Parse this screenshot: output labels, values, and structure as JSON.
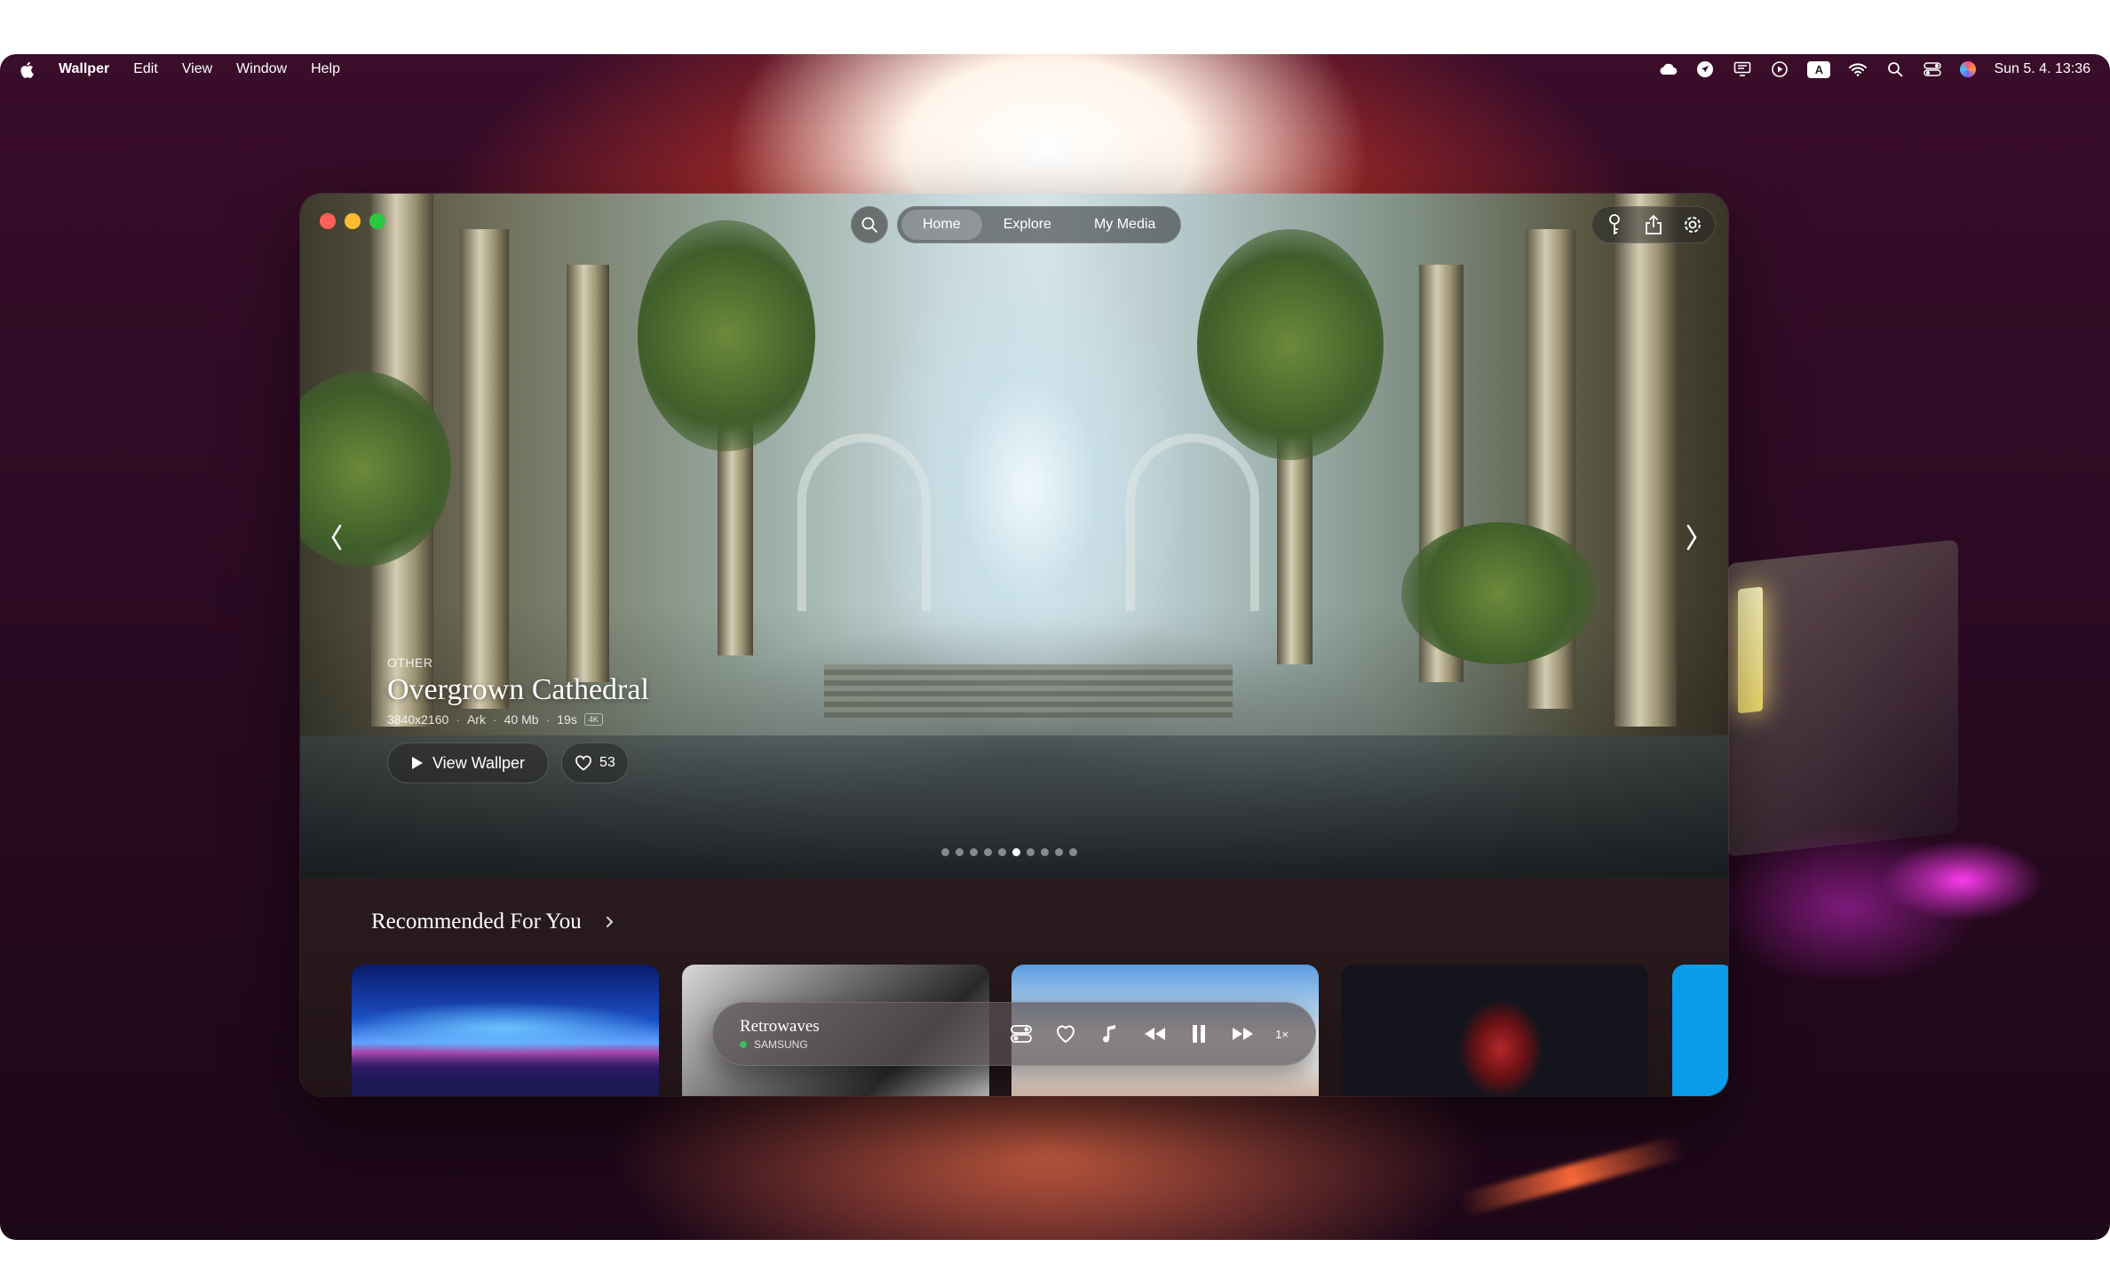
{
  "menubar": {
    "app_name": "Wallper",
    "items": [
      "Edit",
      "View",
      "Window",
      "Help"
    ],
    "badge_letter": "A",
    "datetime": "Sun 5. 4.  13:36",
    "icons": [
      "cloud-icon",
      "send-icon",
      "display-icon",
      "play-circle-icon",
      "input-source-icon",
      "wifi-icon",
      "search-icon",
      "control-center-icon",
      "siri-icon"
    ]
  },
  "window": {
    "nav": {
      "tabs": [
        "Home",
        "Explore",
        "My Media"
      ],
      "active_tab": "Home"
    },
    "tools": [
      "key-icon",
      "share-icon",
      "settings-icon"
    ],
    "hero": {
      "category": "OTHER",
      "title": "Overgrown Cathedral",
      "resolution": "3840x2160",
      "author": "Ark",
      "size": "40 Mb",
      "duration": "19s",
      "tag": "4K",
      "view_label": "View Wallper",
      "likes": "53",
      "slide_count": 10,
      "active_slide": 5
    },
    "section": {
      "title": "Recommended For You"
    },
    "player": {
      "title": "Retrowaves",
      "source": "SAMSUNG",
      "speed": "1×"
    }
  },
  "colors": {
    "close": "#ff5f57",
    "minimize": "#febc2e",
    "maximize": "#28c840",
    "live": "#33d26a",
    "accent_card": "#0a9bea"
  }
}
